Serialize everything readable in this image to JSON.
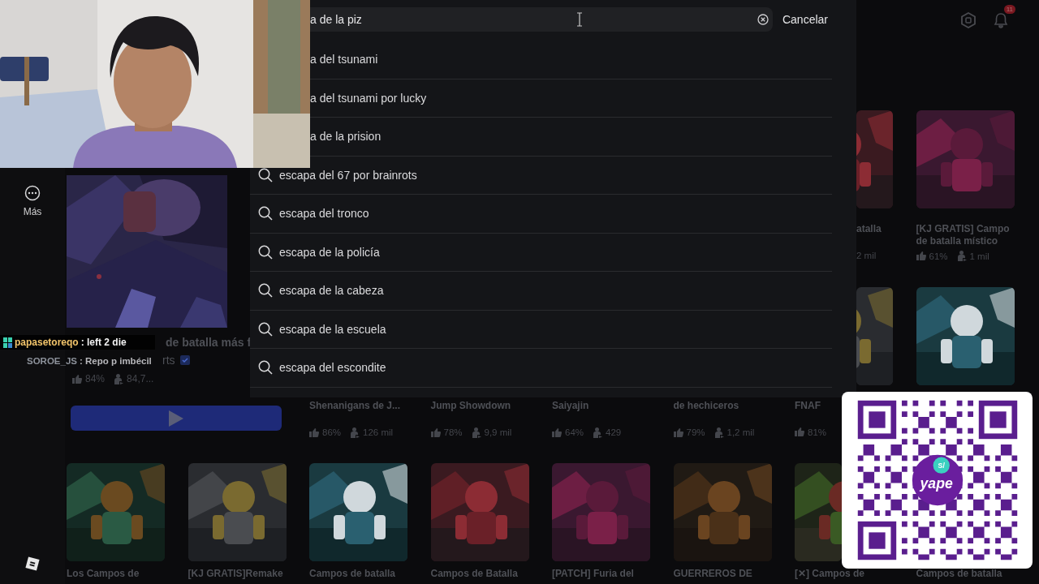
{
  "search": {
    "value": "a de la piz",
    "cancel": "Cancelar"
  },
  "suggestions": [
    {
      "text": "a del tsunami",
      "covered": true
    },
    {
      "text": "a del tsunami por lucky",
      "covered": true
    },
    {
      "text": "a de la prision",
      "covered": true
    },
    {
      "text": "escapa del 67 por brainrots",
      "covered": false
    },
    {
      "text": "escapa del tronco",
      "covered": false
    },
    {
      "text": "escapa de la policía",
      "covered": false
    },
    {
      "text": "escapa de la cabeza",
      "covered": false
    },
    {
      "text": "escapa de la escuela",
      "covered": false
    },
    {
      "text": "escapa del escondite",
      "covered": false
    }
  ],
  "sidebar": {
    "more": "Más"
  },
  "notifications": {
    "count": "11"
  },
  "featured": {
    "title": "de batalla más f",
    "subtitle": "rts",
    "verified": true,
    "rating": "84%",
    "players": "84,7..."
  },
  "rows": [
    {
      "cards": [
        {
          "kind": "right",
          "cut_left": true,
          "title": "atalla",
          "players": "2 mil"
        },
        {
          "kind": "full",
          "cut_left": false,
          "title": "[KJ GRATIS] Campo de batalla místico",
          "rating": "61%",
          "players": "1 mil"
        }
      ]
    },
    {
      "cards": [
        {
          "title": "Shenanigans de J...",
          "rating": "86%",
          "players": "126 mil"
        },
        {
          "title": "Jump Showdown",
          "rating": "78%",
          "players": "9,9 mil"
        },
        {
          "title": "Saiyajin",
          "rating": "64%",
          "players": "429"
        },
        {
          "title": "de hechiceros",
          "rating": "79%",
          "players": "1,2 mil"
        },
        {
          "kind": "right",
          "title": "FNAF",
          "rating": "81%"
        },
        {
          "kind": "full"
        }
      ]
    },
    {
      "cards": [
        {
          "kind": "full",
          "title": "Los Campos de"
        },
        {
          "kind": "full",
          "title": "[KJ GRATIS]Remake"
        },
        {
          "kind": "full",
          "title": "Campos de batalla"
        },
        {
          "kind": "full",
          "title": "Campos de Batalla"
        },
        {
          "kind": "full",
          "title": "[PATCH] Furia del"
        },
        {
          "kind": "full",
          "title": "GUERREROS DE"
        },
        {
          "kind": "left",
          "title": "[✕] Campos de"
        },
        {
          "title": "Campos de batalla"
        }
      ]
    }
  ],
  "chat": [
    {
      "user": "papasetoreqo",
      "message": ": left 2 die",
      "color": "#f2c46a",
      "badge": true
    },
    {
      "user": "SOROE_JS",
      "message": ": Repo p imbécil",
      "color": "#8d929b",
      "badge": false
    }
  ],
  "qr": {
    "logo": "yape",
    "currency": "S/"
  }
}
